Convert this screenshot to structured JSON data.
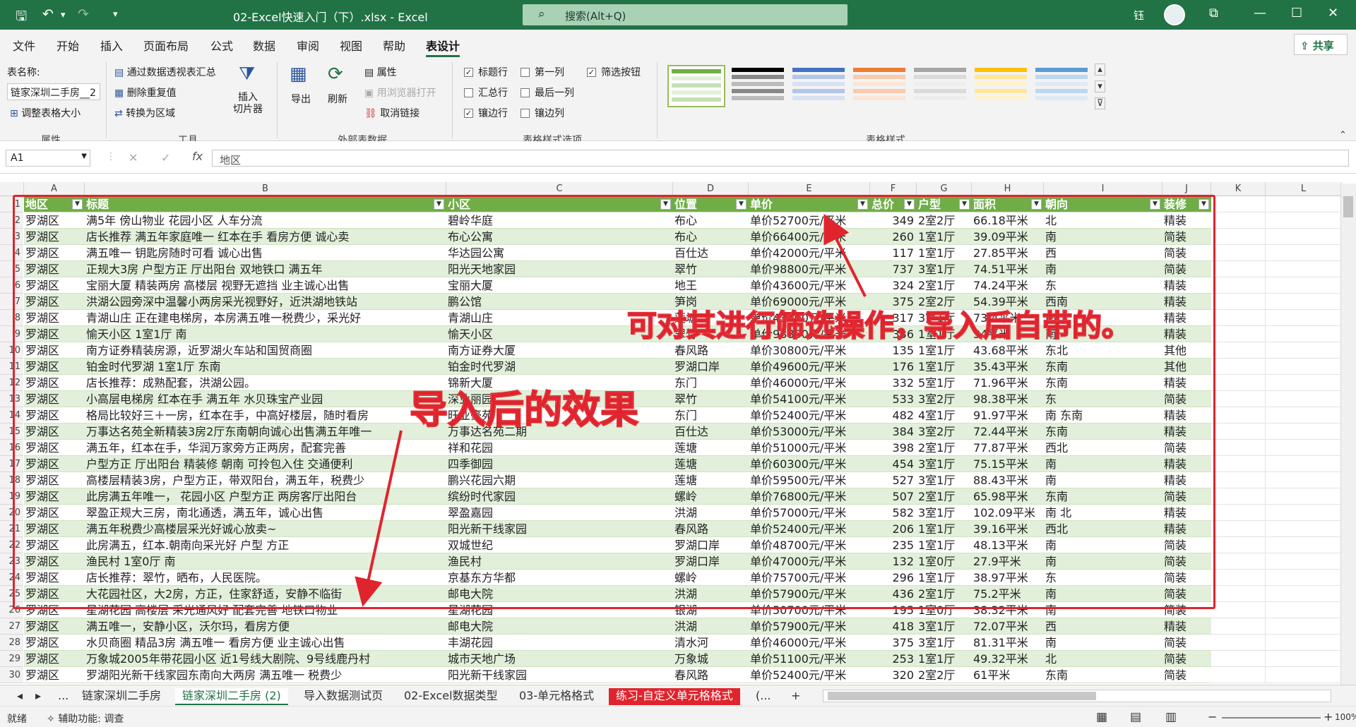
{
  "titlebar": {
    "save_icon": "save-icon",
    "undo_icon": "undo-icon",
    "redo_icon": "redo-icon",
    "doc_title": "02-Excel快速入门（下）.xlsx  -  Excel",
    "search_placeholder": "搜索(Alt+Q)",
    "user": "钰",
    "min": "—",
    "max": "☐",
    "close": "✕",
    "restore": "⧉"
  },
  "tabs": [
    "文件",
    "开始",
    "插入",
    "页面布局",
    "公式",
    "数据",
    "审阅",
    "视图",
    "帮助",
    "表设计"
  ],
  "share": "共享",
  "ribbon": {
    "props": {
      "name_label": "表名称:",
      "name_value": "链家深圳二手房__2",
      "resize": "调整表格大小",
      "group": "属性"
    },
    "tools": {
      "pivot": "通过数据透视表汇总",
      "dedupe": "删除重复值",
      "convert": "转换为区域",
      "slicer": "插入\n切片器",
      "group": "工具"
    },
    "external": {
      "export": "导出",
      "refresh": "刷新",
      "props": "属性",
      "browser": "用浏览器打开",
      "unlink": "取消链接",
      "group": "外部表数据"
    },
    "options": {
      "header_row": "标题行",
      "total_row": "汇总行",
      "banded_rows": "镶边行",
      "first_col": "第一列",
      "last_col": "最后一列",
      "banded_cols": "镶边列",
      "filter_btn": "筛选按钮",
      "group": "表格样式选项"
    },
    "styles": {
      "group": "表格样式"
    }
  },
  "formula": {
    "namebox": "A1",
    "value": "地区",
    "fx": "fx",
    "cancel": "✕",
    "enter": "✓"
  },
  "columns": [
    "A",
    "B",
    "C",
    "D",
    "E",
    "F",
    "G",
    "H",
    "I",
    "J",
    "K",
    "L"
  ],
  "headers": [
    "地区",
    "标题",
    "小区",
    "位置",
    "单价",
    "总价",
    "户型",
    "面积",
    "朝向",
    "装修"
  ],
  "rows": [
    [
      "罗湖区",
      "满5年 傍山物业  花园小区  人车分流",
      "碧岭华庭",
      "布心",
      "单价52700元/平米",
      "349",
      "2室2厅",
      "66.18平米",
      "北",
      "精装"
    ],
    [
      "罗湖区",
      "店长推荐 满五年家庭唯一 红本在手 看房方便 诚心卖",
      "布心公寓",
      "布心",
      "单价66400元/平米",
      "260",
      "1室1厅",
      "39.09平米",
      "南",
      "简装"
    ],
    [
      "罗湖区",
      "满五唯一 钥匙房随时可看 诚心出售",
      "华达园公寓",
      "百仕达",
      "单价42000元/平米",
      "117",
      "1室1厅",
      "27.85平米",
      "西",
      "简装"
    ],
    [
      "罗湖区",
      "正规大3房 户型方正 厅出阳台 双地铁口 满五年",
      "阳光天地家园",
      "翠竹",
      "单价98800元/平米",
      "737",
      "3室1厅",
      "74.51平米",
      "南",
      "简装"
    ],
    [
      "罗湖区",
      "宝丽大厦 精装两房 高楼层 视野无遮挡  业主诚心出售",
      "宝丽大厦",
      "地王",
      "单价43600元/平米",
      "324",
      "2室1厅",
      "74.24平米",
      "东",
      "精装"
    ],
    [
      "罗湖区",
      "洪湖公园旁深中温馨小两房采光视野好，近洪湖地铁站",
      "鹏公馆",
      "笋岗",
      "单价69000元/平米",
      "375",
      "2室2厅",
      "54.39平米",
      "西南",
      "精装"
    ],
    [
      "罗湖区",
      "青湖山庄 正在建电梯房，本房满五唯一税费少，采光好",
      "青湖山庄",
      "莲塘",
      "单价43000元/平米",
      "317",
      "3室1厅",
      "73.4平米",
      "南",
      "精装"
    ],
    [
      "罗湖区",
      "愉天小区 1室1厅 南",
      "愉天小区",
      "翠竹",
      "单价98800元/平米",
      "336",
      "1室1厅",
      "34平米",
      "南",
      "精装"
    ],
    [
      "罗湖区",
      "南方证券精装房源，近罗湖火车站和国贸商圈",
      "南方证券大厦",
      "春风路",
      "单价30800元/平米",
      "135",
      "1室1厅",
      "43.68平米",
      "东北",
      "其他"
    ],
    [
      "罗湖区",
      "铂金时代罗湖 1室1厅 东南",
      "铂金时代罗湖",
      "罗湖口岸",
      "单价49600元/平米",
      "176",
      "1室1厅",
      "35.43平米",
      "东南",
      "其他"
    ],
    [
      "罗湖区",
      "店长推荐：成熟配套，洪湖公园。",
      "锦新大厦",
      "东门",
      "单价46000元/平米",
      "332",
      "5室1厅",
      "71.96平米",
      "东南",
      "精装"
    ],
    [
      "罗湖区",
      "小高层电梯房 红本在手 满五年 水贝珠宝产业园",
      "深业丽园",
      "翠竹",
      "单价54100元/平米",
      "533",
      "3室2厅",
      "98.38平米",
      "东",
      "简装"
    ],
    [
      "罗湖区",
      "格局比较好三＋一房，红本在手，中高好楼层，随时看房",
      "旺业豪苑",
      "东门",
      "单价52400元/平米",
      "482",
      "4室1厅",
      "91.97平米",
      "南 东南",
      "精装"
    ],
    [
      "罗湖区",
      "万事达名苑全新精装3房2厅东南朝向诚心出售满五年唯一",
      "万事达名苑二期",
      "百仕达",
      "单价53000元/平米",
      "384",
      "3室2厅",
      "72.44平米",
      "东南",
      "精装"
    ],
    [
      "罗湖区",
      "满五年，红本在手，华润万家旁方正两房，配套完善",
      "祥和花园",
      "莲塘",
      "单价51000元/平米",
      "398",
      "2室1厅",
      "77.87平米",
      "西北",
      "简装"
    ],
    [
      "罗湖区",
      "户型方正 厅出阳台  精装修 朝南 可拎包入住 交通便利",
      "四季御园",
      "莲塘",
      "单价60300元/平米",
      "454",
      "3室1厅",
      "75.15平米",
      "南",
      "精装"
    ],
    [
      "罗湖区",
      "高楼层精装3房，户型方正，带双阳台，满五年，税费少",
      "鹏兴花园六期",
      "莲塘",
      "单价59500元/平米",
      "527",
      "3室1厅",
      "88.43平米",
      "南",
      "精装"
    ],
    [
      "罗湖区",
      "此房满五年唯一，  花园小区 户型方正  两房客厅出阳台",
      "缤纷时代家园",
      "螺岭",
      "单价76800元/平米",
      "507",
      "2室1厅",
      "65.98平米",
      "东南",
      "简装"
    ],
    [
      "罗湖区",
      "翠盈正规大三房，南北通透，满五年，诚心出售",
      "翠盈嘉园",
      "洪湖",
      "单价57000元/平米",
      "582",
      "3室1厅",
      "102.09平米",
      "南 北",
      "精装"
    ],
    [
      "罗湖区",
      "满五年税费少高楼层采光好诚心放卖~",
      "阳光新干线家园",
      "春风路",
      "单价52400元/平米",
      "206",
      "1室1厅",
      "39.16平米",
      "西北",
      "精装"
    ],
    [
      "罗湖区",
      "此房满五，红本.朝南向采光好 户型 方正",
      "双城世纪",
      "罗湖口岸",
      "单价48700元/平米",
      "235",
      "1室1厅",
      "48.13平米",
      "南",
      "简装"
    ],
    [
      "罗湖区",
      "渔民村 1室0厅 南",
      "渔民村",
      "罗湖口岸",
      "单价47000元/平米",
      "132",
      "1室0厅",
      "27.9平米",
      "南",
      "简装"
    ],
    [
      "罗湖区",
      "店长推荐：翠竹，晒布，人民医院。",
      "京基东方华都",
      "螺岭",
      "单价75700元/平米",
      "296",
      "1室1厅",
      "38.97平米",
      "东",
      "简装"
    ],
    [
      "罗湖区",
      "大花园社区，大2房，方正，住家舒适，安静不临街",
      "邮电大院",
      "洪湖",
      "单价57900元/平米",
      "436",
      "2室1厅",
      "75.2平米",
      "南",
      "简装"
    ],
    [
      "罗湖区",
      "星湖花园 高楼层 采光通风好 配套完善 地铁口物业",
      "星湖花园",
      "银湖",
      "单价50700元/平米",
      "195",
      "1室0厅",
      "38.32平米",
      "南",
      "简装"
    ],
    [
      "罗湖区",
      "满五唯一，安静小区，沃尔玛，看房方便",
      "邮电大院",
      "洪湖",
      "单价57900元/平米",
      "418",
      "3室1厅",
      "72.07平米",
      "西",
      "精装"
    ],
    [
      "罗湖区",
      "水贝商圈 精品3房 满五唯一 看房方便 业主诚心出售",
      "丰湖花园",
      "清水河",
      "单价46000元/平米",
      "375",
      "3室1厅",
      "81.31平米",
      "南",
      "简装"
    ],
    [
      "罗湖区",
      "万象城2005年带花园小区 近1号线大剧院、9号线鹿丹村",
      "城市天地广场",
      "万象城",
      "单价51100元/平米",
      "253",
      "1室1厅",
      "49.32平米",
      "北",
      "简装"
    ],
    [
      "罗湖区",
      "罗湖阳光新干线家园东南向大两房 满五唯一 税费少",
      "阳光新干线家园",
      "春风路",
      "单价52400元/平米",
      "320",
      "2室2厅",
      "61平米",
      "东南",
      "简装"
    ]
  ],
  "annotations": {
    "top": "可对其进行筛选操作，导入后自带的。",
    "left": "导入后的效果"
  },
  "sheets": [
    "◂",
    "▸",
    "...",
    "链家深圳二手房",
    "链家深圳二手房 (2)",
    "导入数据测试页",
    "02-Excel数据类型",
    "03-单元格格式",
    "练习-自定义单元格格式",
    "(...",
    "+"
  ],
  "status": {
    "ready": "就绪",
    "accessibility": "辅助功能: 调查",
    "zoom": "100%"
  },
  "colors": {
    "brand": "#217346",
    "header": "#70ad47",
    "band": "#e2efda",
    "annotation": "#e0242d"
  }
}
